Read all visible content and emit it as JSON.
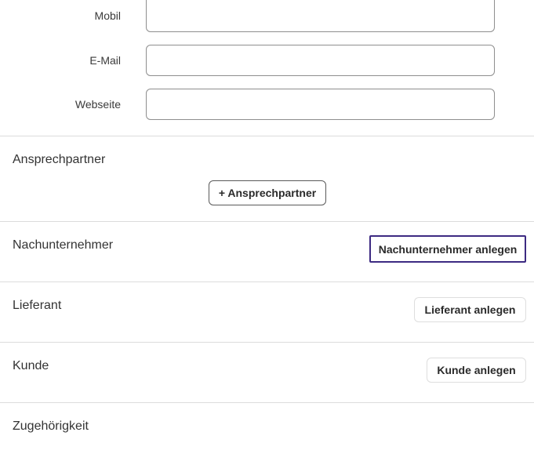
{
  "contact_fields": {
    "mobil": {
      "label": "Mobil",
      "value": ""
    },
    "email": {
      "label": "E-Mail",
      "value": ""
    },
    "webseite": {
      "label": "Webseite",
      "value": ""
    }
  },
  "sections": {
    "ansprechpartner": {
      "title": "Ansprechpartner",
      "button_label": "+ Ansprechpartner"
    },
    "nachunternehmer": {
      "title": "Nachunternehmer",
      "button_label": "Nachunternehmer anlegen"
    },
    "lieferant": {
      "title": "Lieferant",
      "button_label": "Lieferant anlegen"
    },
    "kunde": {
      "title": "Kunde",
      "button_label": "Kunde anlegen"
    },
    "zugehoerigkeit": {
      "title": "Zugehörigkeit"
    }
  },
  "colors": {
    "focus_ring": "#3d2a82",
    "divider": "#dcdcdc",
    "input_border": "#8e8e8e"
  }
}
